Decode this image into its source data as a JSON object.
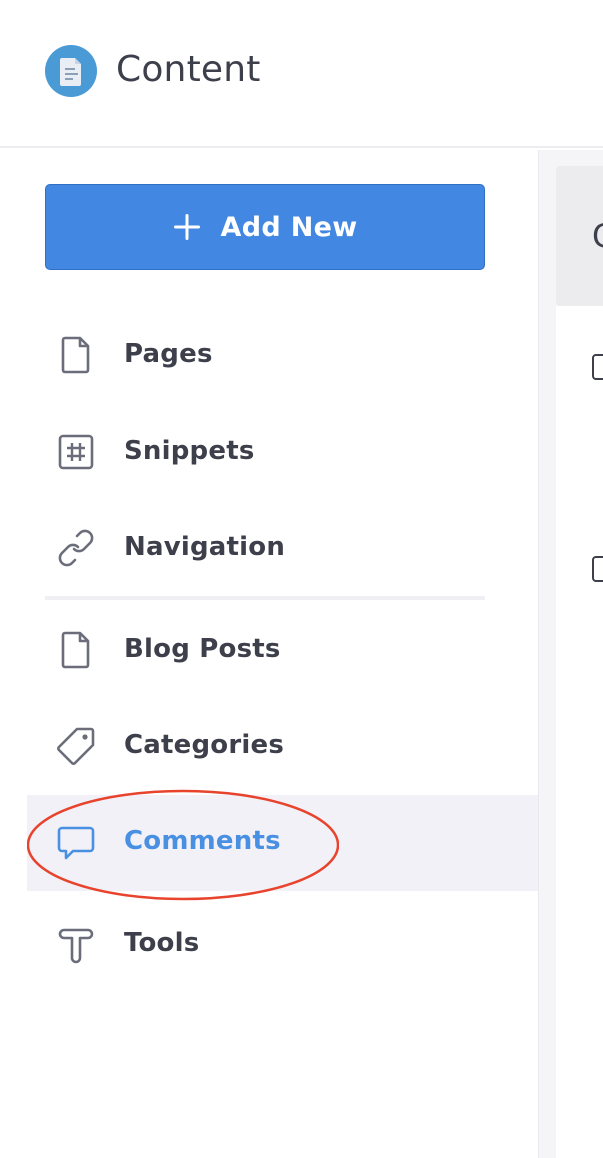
{
  "header": {
    "title": "Content",
    "icon": "document-icon",
    "icon_color": "#4a9ad6"
  },
  "sidebar": {
    "add_button": {
      "label": "Add New",
      "icon": "plus-icon",
      "color": "#4287e2"
    },
    "items": [
      {
        "label": "Pages",
        "icon": "page-icon"
      },
      {
        "label": "Snippets",
        "icon": "hash-icon"
      },
      {
        "label": "Navigation",
        "icon": "link-icon"
      },
      {
        "label": "Blog Posts",
        "icon": "page-icon"
      },
      {
        "label": "Categories",
        "icon": "tag-icon"
      },
      {
        "label": "Comments",
        "icon": "comment-icon",
        "active": true
      },
      {
        "label": "Tools",
        "icon": "tool-icon"
      }
    ],
    "active_color": "#4a90e2"
  },
  "main": {
    "card_text": "C"
  },
  "annotation": {
    "color": "#e8432d",
    "target": "Comments"
  }
}
